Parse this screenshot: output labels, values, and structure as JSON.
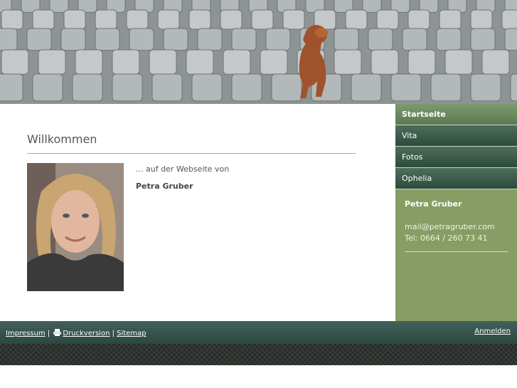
{
  "content": {
    "heading": "Willkommen",
    "intro": "... auf der Webseite von",
    "name": "Petra Gruber"
  },
  "nav": {
    "items": [
      {
        "label": "Startseite",
        "active": true
      },
      {
        "label": "Vita"
      },
      {
        "label": "Fotos"
      },
      {
        "label": "Ophelia"
      }
    ]
  },
  "contact": {
    "name": "Petra Gruber",
    "email": "mail@petragruber.com",
    "phone": "Tel: 0664 / 260 73 41"
  },
  "footer": {
    "impressum": "Impressum",
    "separator": "|",
    "print": "Druckversion",
    "sitemap": "Sitemap",
    "login": "Anmelden"
  },
  "colors": {
    "sidebar": "#879d63",
    "nav": "#3d5c4c",
    "footer": "#36544c"
  }
}
